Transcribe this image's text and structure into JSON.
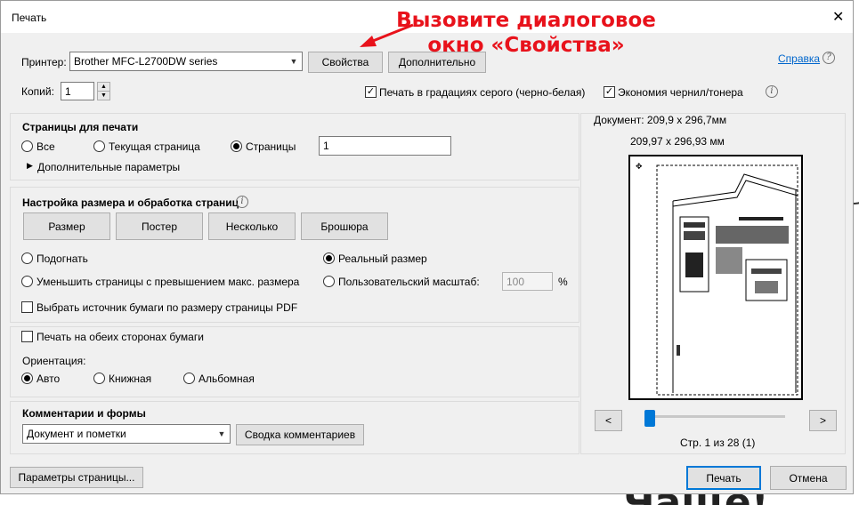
{
  "background_text": "Чаще!",
  "window": {
    "title": "Печать",
    "close_label": "✕"
  },
  "annotation": {
    "line1": "Вызовите диалоговое",
    "line2": "окно «Свойства»"
  },
  "printer": {
    "label": "Принтер:",
    "selected": "Brother MFC-L2700DW series",
    "properties_button": "Свойства",
    "advanced_button": "Дополнительно",
    "help_link": "Справка"
  },
  "copies": {
    "label": "Копий:",
    "value": "1"
  },
  "options": {
    "grayscale_label": "Печать в градациях серого (черно-белая)",
    "grayscale_checked": true,
    "save_ink_label": "Экономия чернил/тонера",
    "save_ink_checked": true
  },
  "pages_section": {
    "title": "Страницы для печати",
    "all_label": "Все",
    "current_label": "Текущая страница",
    "pages_label": "Страницы",
    "pages_value": "1",
    "more_options_label": "Дополнительные параметры",
    "selected": "pages"
  },
  "sizing_section": {
    "title": "Настройка размера и обработка страниц",
    "tabs": [
      "Размер",
      "Постер",
      "Несколько",
      "Брошюра"
    ],
    "fit_label": "Подогнать",
    "actual_size_label": "Реальный размер",
    "shrink_label": "Уменьшить страницы с превышением макс. размера",
    "custom_scale_label": "Пользовательский масштаб:",
    "custom_scale_value": "100",
    "percent": "%",
    "choose_source_label": "Выбрать источник бумаги по размеру страницы PDF",
    "selected": "actual"
  },
  "duplex": {
    "label": "Печать на обеих сторонах бумаги",
    "checked": false
  },
  "orientation": {
    "title": "Ориентация:",
    "auto_label": "Авто",
    "portrait_label": "Книжная",
    "landscape_label": "Альбомная",
    "selected": "auto"
  },
  "comments": {
    "title": "Комментарии и формы",
    "selected": "Документ и пометки",
    "summary_button": "Сводка комментариев"
  },
  "preview": {
    "document_size": "Документ: 209,9 x 296,7мм",
    "paper_size": "209,97 x 296,93 мм",
    "page_info": "Стр. 1 из 28 (1)",
    "prev_label": "<",
    "next_label": ">",
    "thumb_title": "Весна!",
    "thumb_logo": "Ус_мы",
    "thumb_box_text": "тестовый квадрат 5x5 см"
  },
  "footer": {
    "page_setup_button": "Параметры страницы...",
    "print_button": "Печать",
    "cancel_button": "Отмена"
  }
}
